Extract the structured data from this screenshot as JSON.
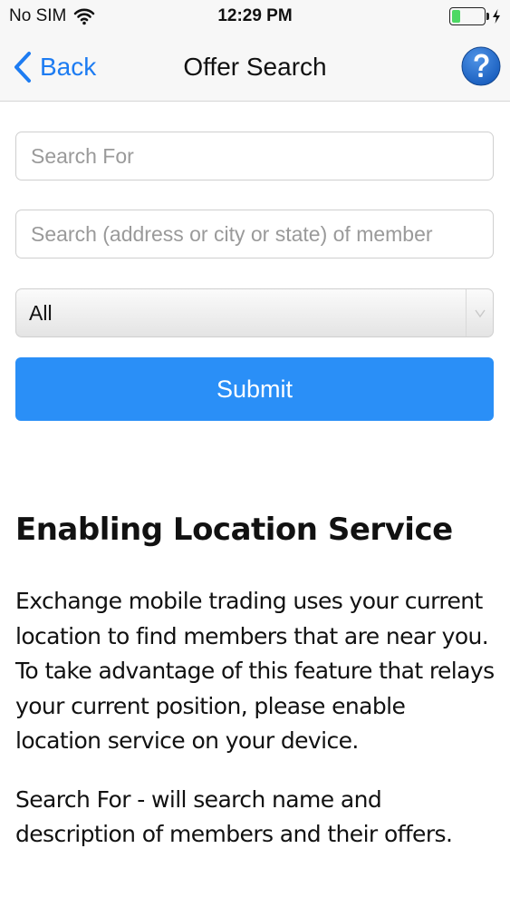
{
  "status_bar": {
    "carrier": "No SIM",
    "time": "12:29 PM",
    "battery_level": 0.25
  },
  "nav": {
    "back_label": "Back",
    "title": "Offer Search",
    "help_icon": "question-circle-icon"
  },
  "form": {
    "search_for_placeholder": "Search For",
    "search_for_value": "",
    "location_placeholder": "Search (address or city or state) of member",
    "location_value": "",
    "category_selected": "All",
    "submit_label": "Submit"
  },
  "info": {
    "title": "Enabling Location Service",
    "paragraph_1": "Exchange mobile trading uses your current location to find members that are near you. To take  advantage of this feature that relays your current position, please enable location service on your device.",
    "paragraph_2": "Search For - will search name and description of members and their offers."
  },
  "colors": {
    "accent": "#1d7cf2",
    "submit_bg": "#2a8ff7",
    "help_icon": "#1a5fbf",
    "battery_fill": "#4cd964"
  }
}
